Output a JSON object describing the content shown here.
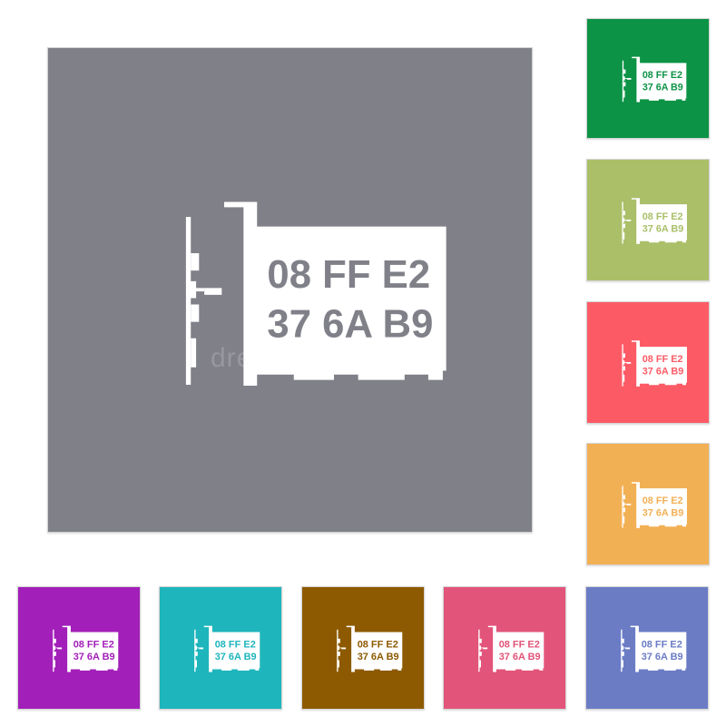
{
  "icon": {
    "name": "network-card-icon",
    "mac_line1": "08 FF E2",
    "mac_line2": "37 6A B9",
    "card_color": "#ffffff"
  },
  "watermark": "dreamstime",
  "tiles": [
    {
      "id": "main",
      "color": "#808089"
    },
    {
      "id": "t1",
      "color": "#0c9346"
    },
    {
      "id": "t2",
      "color": "#aabf68"
    },
    {
      "id": "t3",
      "color": "#fc5b66"
    },
    {
      "id": "t4",
      "color": "#f2b055"
    },
    {
      "id": "b1",
      "color": "#a21fb9"
    },
    {
      "id": "b2",
      "color": "#1eb5bc"
    },
    {
      "id": "b3",
      "color": "#8d5a01"
    },
    {
      "id": "b4",
      "color": "#e2547a"
    },
    {
      "id": "b5",
      "color": "#6b7cc5"
    }
  ]
}
